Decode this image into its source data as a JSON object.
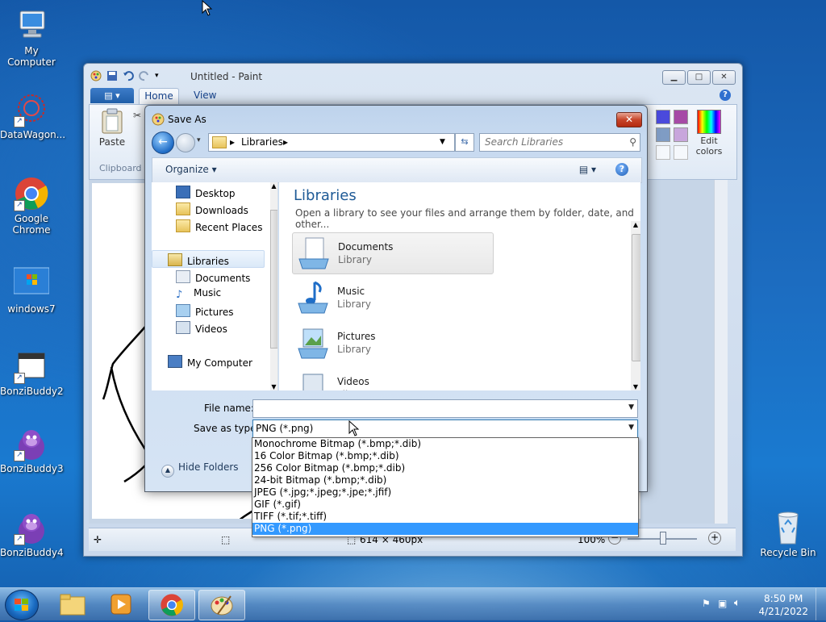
{
  "desktop": {
    "icons": [
      {
        "label": "My Computer"
      },
      {
        "label": "DataWagon..."
      },
      {
        "label": "Google Chrome"
      },
      {
        "label": "windows7"
      },
      {
        "label": "BonziBuddy2"
      },
      {
        "label": "BonziBuddy3"
      },
      {
        "label": "BonziBuddy4"
      },
      {
        "label": "Recycle Bin"
      }
    ]
  },
  "paint": {
    "title": "Untitled - Paint",
    "tabs": {
      "home": "Home",
      "view": "View"
    },
    "clipboard": {
      "paste": "Paste",
      "group": "Clipboard"
    },
    "colors": {
      "edit": "Edit",
      "edit2": "colors"
    },
    "status": {
      "dimensions": "614 × 460px",
      "zoom": "100%"
    }
  },
  "dialog": {
    "title": "Save As",
    "breadcrumb": "Libraries",
    "search_placeholder": "Search Libraries",
    "organize": "Organize",
    "nav": {
      "desktop": "Desktop",
      "downloads": "Downloads",
      "recent": "Recent Places",
      "libraries": "Libraries",
      "documents": "Documents",
      "music": "Music",
      "pictures": "Pictures",
      "videos": "Videos",
      "my_computer": "My Computer"
    },
    "heading": "Libraries",
    "subheading": "Open a library to see your files and arrange them by folder, date, and other...",
    "libraries": [
      {
        "name": "Documents",
        "type": "Library"
      },
      {
        "name": "Music",
        "type": "Library"
      },
      {
        "name": "Pictures",
        "type": "Library"
      },
      {
        "name": "Videos",
        "type": "Library"
      }
    ],
    "file_name_label": "File name:",
    "file_name_value": "",
    "save_as_type_label": "Save as type:",
    "save_as_type_value": "PNG (*.png)",
    "hide_folders": "Hide Folders",
    "type_options": [
      "Monochrome Bitmap (*.bmp;*.dib)",
      "16 Color Bitmap (*.bmp;*.dib)",
      "256 Color Bitmap (*.bmp;*.dib)",
      "24-bit Bitmap (*.bmp;*.dib)",
      "JPEG (*.jpg;*.jpeg;*.jpe;*.jfif)",
      "GIF (*.gif)",
      "TIFF (*.tif;*.tiff)",
      "PNG (*.png)"
    ]
  },
  "taskbar": {
    "time": "8:50 PM",
    "date": "4/21/2022"
  }
}
